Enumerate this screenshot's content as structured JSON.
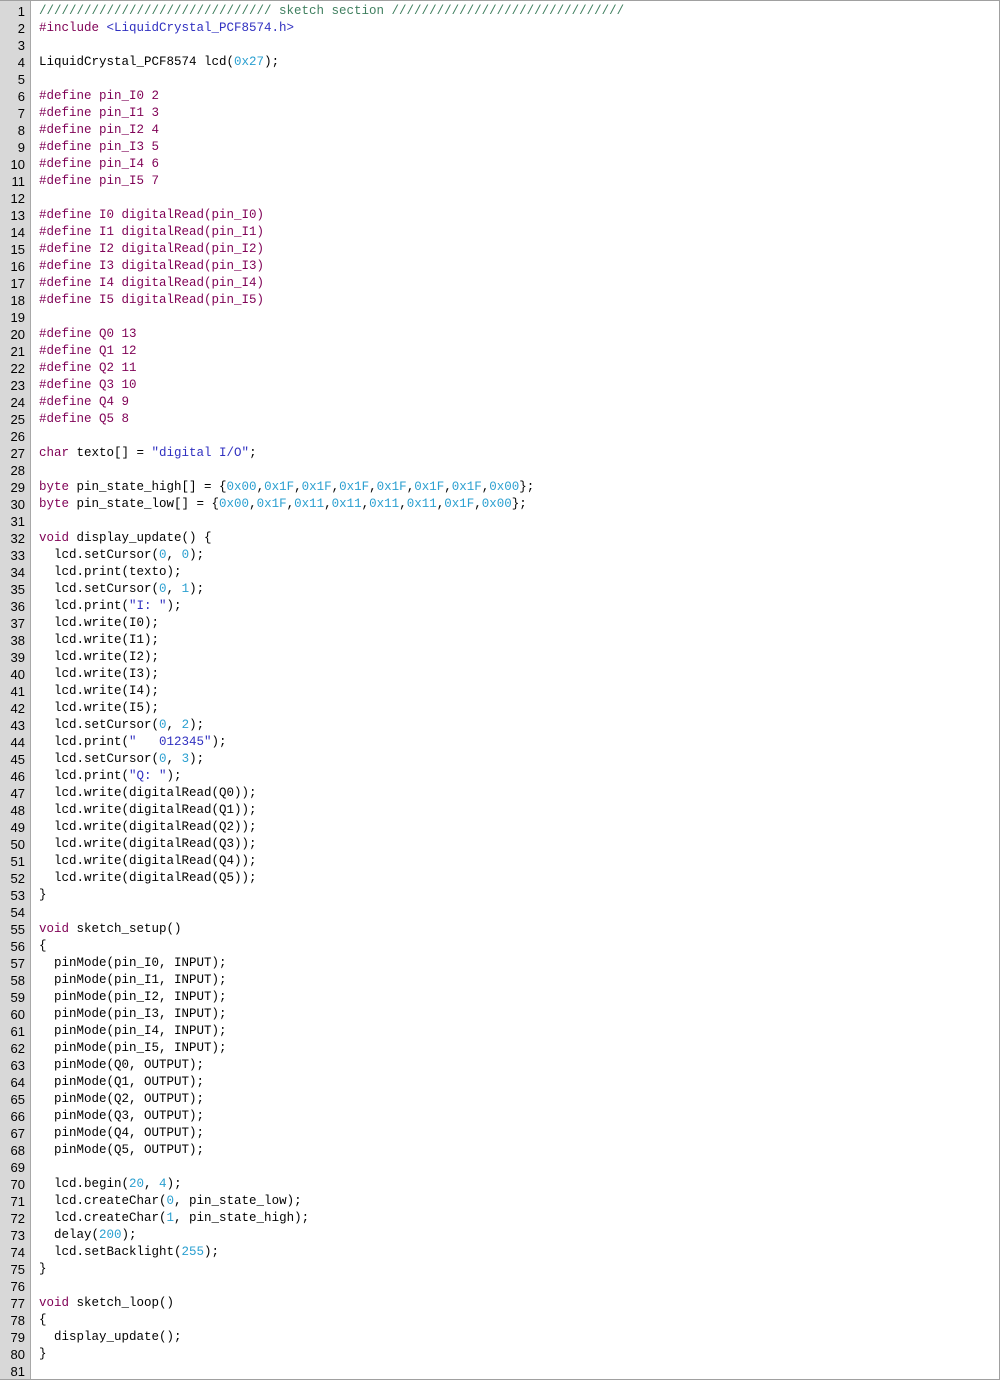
{
  "colors": {
    "keyword": "#7f0055",
    "number": "#2a9fd0",
    "string": "#3030c0",
    "comment": "#3f7f5f",
    "plain": "#000000",
    "gutter": "#d8d8d8"
  },
  "editor": {
    "lines": [
      {
        "n": "1",
        "tokens": [
          {
            "t": "cm",
            "s": "/////////////////////////////// sketch section ///////////////////////////////"
          }
        ]
      },
      {
        "n": "2",
        "tokens": [
          {
            "t": "kw",
            "s": "#include "
          },
          {
            "t": "str",
            "s": "<LiquidCrystal_PCF8574.h>"
          }
        ]
      },
      {
        "n": "3",
        "tokens": []
      },
      {
        "n": "4",
        "tokens": [
          {
            "t": "plain",
            "s": "LiquidCrystal_PCF8574 lcd("
          },
          {
            "t": "num",
            "s": "0x27"
          },
          {
            "t": "plain",
            "s": ");"
          }
        ]
      },
      {
        "n": "5",
        "tokens": []
      },
      {
        "n": "6",
        "tokens": [
          {
            "t": "kw",
            "s": "#define pin_I0 2"
          }
        ]
      },
      {
        "n": "7",
        "tokens": [
          {
            "t": "kw",
            "s": "#define pin_I1 3"
          }
        ]
      },
      {
        "n": "8",
        "tokens": [
          {
            "t": "kw",
            "s": "#define pin_I2 4"
          }
        ]
      },
      {
        "n": "9",
        "tokens": [
          {
            "t": "kw",
            "s": "#define pin_I3 5"
          }
        ]
      },
      {
        "n": "10",
        "tokens": [
          {
            "t": "kw",
            "s": "#define pin_I4 6"
          }
        ]
      },
      {
        "n": "11",
        "tokens": [
          {
            "t": "kw",
            "s": "#define pin_I5 7"
          }
        ]
      },
      {
        "n": "12",
        "tokens": []
      },
      {
        "n": "13",
        "tokens": [
          {
            "t": "kw",
            "s": "#define I0 digitalRead(pin_I0)"
          }
        ]
      },
      {
        "n": "14",
        "tokens": [
          {
            "t": "kw",
            "s": "#define I1 digitalRead(pin_I1)"
          }
        ]
      },
      {
        "n": "15",
        "tokens": [
          {
            "t": "kw",
            "s": "#define I2 digitalRead(pin_I2)"
          }
        ]
      },
      {
        "n": "16",
        "tokens": [
          {
            "t": "kw",
            "s": "#define I3 digitalRead(pin_I3)"
          }
        ]
      },
      {
        "n": "17",
        "tokens": [
          {
            "t": "kw",
            "s": "#define I4 digitalRead(pin_I4)"
          }
        ]
      },
      {
        "n": "18",
        "tokens": [
          {
            "t": "kw",
            "s": "#define I5 digitalRead(pin_I5)"
          }
        ]
      },
      {
        "n": "19",
        "tokens": []
      },
      {
        "n": "20",
        "tokens": [
          {
            "t": "kw",
            "s": "#define Q0 13"
          }
        ]
      },
      {
        "n": "21",
        "tokens": [
          {
            "t": "kw",
            "s": "#define Q1 12"
          }
        ]
      },
      {
        "n": "22",
        "tokens": [
          {
            "t": "kw",
            "s": "#define Q2 11"
          }
        ]
      },
      {
        "n": "23",
        "tokens": [
          {
            "t": "kw",
            "s": "#define Q3 10"
          }
        ]
      },
      {
        "n": "24",
        "tokens": [
          {
            "t": "kw",
            "s": "#define Q4 9"
          }
        ]
      },
      {
        "n": "25",
        "tokens": [
          {
            "t": "kw",
            "s": "#define Q5 8"
          }
        ]
      },
      {
        "n": "26",
        "tokens": []
      },
      {
        "n": "27",
        "tokens": [
          {
            "t": "kw",
            "s": "char"
          },
          {
            "t": "plain",
            "s": " texto[] = "
          },
          {
            "t": "str",
            "s": "\"digital I/O\""
          },
          {
            "t": "plain",
            "s": ";"
          }
        ]
      },
      {
        "n": "28",
        "tokens": []
      },
      {
        "n": "29",
        "tokens": [
          {
            "t": "kw",
            "s": "byte"
          },
          {
            "t": "plain",
            "s": " pin_state_high[] = {"
          },
          {
            "t": "num",
            "s": "0x00"
          },
          {
            "t": "plain",
            "s": ","
          },
          {
            "t": "num",
            "s": "0x1F"
          },
          {
            "t": "plain",
            "s": ","
          },
          {
            "t": "num",
            "s": "0x1F"
          },
          {
            "t": "plain",
            "s": ","
          },
          {
            "t": "num",
            "s": "0x1F"
          },
          {
            "t": "plain",
            "s": ","
          },
          {
            "t": "num",
            "s": "0x1F"
          },
          {
            "t": "plain",
            "s": ","
          },
          {
            "t": "num",
            "s": "0x1F"
          },
          {
            "t": "plain",
            "s": ","
          },
          {
            "t": "num",
            "s": "0x1F"
          },
          {
            "t": "plain",
            "s": ","
          },
          {
            "t": "num",
            "s": "0x00"
          },
          {
            "t": "plain",
            "s": "};"
          }
        ]
      },
      {
        "n": "30",
        "tokens": [
          {
            "t": "kw",
            "s": "byte"
          },
          {
            "t": "plain",
            "s": " pin_state_low[] = {"
          },
          {
            "t": "num",
            "s": "0x00"
          },
          {
            "t": "plain",
            "s": ","
          },
          {
            "t": "num",
            "s": "0x1F"
          },
          {
            "t": "plain",
            "s": ","
          },
          {
            "t": "num",
            "s": "0x11"
          },
          {
            "t": "plain",
            "s": ","
          },
          {
            "t": "num",
            "s": "0x11"
          },
          {
            "t": "plain",
            "s": ","
          },
          {
            "t": "num",
            "s": "0x11"
          },
          {
            "t": "plain",
            "s": ","
          },
          {
            "t": "num",
            "s": "0x11"
          },
          {
            "t": "plain",
            "s": ","
          },
          {
            "t": "num",
            "s": "0x1F"
          },
          {
            "t": "plain",
            "s": ","
          },
          {
            "t": "num",
            "s": "0x00"
          },
          {
            "t": "plain",
            "s": "};"
          }
        ]
      },
      {
        "n": "31",
        "tokens": []
      },
      {
        "n": "32",
        "tokens": [
          {
            "t": "kw",
            "s": "void"
          },
          {
            "t": "plain",
            "s": " display_update() {"
          }
        ]
      },
      {
        "n": "33",
        "tokens": [
          {
            "t": "plain",
            "s": "  lcd.setCursor("
          },
          {
            "t": "num",
            "s": "0"
          },
          {
            "t": "plain",
            "s": ", "
          },
          {
            "t": "num",
            "s": "0"
          },
          {
            "t": "plain",
            "s": ");"
          }
        ]
      },
      {
        "n": "34",
        "tokens": [
          {
            "t": "plain",
            "s": "  lcd.print(texto);"
          }
        ]
      },
      {
        "n": "35",
        "tokens": [
          {
            "t": "plain",
            "s": "  lcd.setCursor("
          },
          {
            "t": "num",
            "s": "0"
          },
          {
            "t": "plain",
            "s": ", "
          },
          {
            "t": "num",
            "s": "1"
          },
          {
            "t": "plain",
            "s": ");"
          }
        ]
      },
      {
        "n": "36",
        "tokens": [
          {
            "t": "plain",
            "s": "  lcd.print("
          },
          {
            "t": "str",
            "s": "\"I: \""
          },
          {
            "t": "plain",
            "s": ");"
          }
        ]
      },
      {
        "n": "37",
        "tokens": [
          {
            "t": "plain",
            "s": "  lcd.write(I0);"
          }
        ]
      },
      {
        "n": "38",
        "tokens": [
          {
            "t": "plain",
            "s": "  lcd.write(I1);"
          }
        ]
      },
      {
        "n": "39",
        "tokens": [
          {
            "t": "plain",
            "s": "  lcd.write(I2);"
          }
        ]
      },
      {
        "n": "40",
        "tokens": [
          {
            "t": "plain",
            "s": "  lcd.write(I3);"
          }
        ]
      },
      {
        "n": "41",
        "tokens": [
          {
            "t": "plain",
            "s": "  lcd.write(I4);"
          }
        ]
      },
      {
        "n": "42",
        "tokens": [
          {
            "t": "plain",
            "s": "  lcd.write(I5);"
          }
        ]
      },
      {
        "n": "43",
        "tokens": [
          {
            "t": "plain",
            "s": "  lcd.setCursor("
          },
          {
            "t": "num",
            "s": "0"
          },
          {
            "t": "plain",
            "s": ", "
          },
          {
            "t": "num",
            "s": "2"
          },
          {
            "t": "plain",
            "s": ");"
          }
        ]
      },
      {
        "n": "44",
        "tokens": [
          {
            "t": "plain",
            "s": "  lcd.print("
          },
          {
            "t": "str",
            "s": "\"   012345\""
          },
          {
            "t": "plain",
            "s": ");"
          }
        ]
      },
      {
        "n": "45",
        "tokens": [
          {
            "t": "plain",
            "s": "  lcd.setCursor("
          },
          {
            "t": "num",
            "s": "0"
          },
          {
            "t": "plain",
            "s": ", "
          },
          {
            "t": "num",
            "s": "3"
          },
          {
            "t": "plain",
            "s": ");"
          }
        ]
      },
      {
        "n": "46",
        "tokens": [
          {
            "t": "plain",
            "s": "  lcd.print("
          },
          {
            "t": "str",
            "s": "\"Q: \""
          },
          {
            "t": "plain",
            "s": ");"
          }
        ]
      },
      {
        "n": "47",
        "tokens": [
          {
            "t": "plain",
            "s": "  lcd.write(digitalRead(Q0));"
          }
        ]
      },
      {
        "n": "48",
        "tokens": [
          {
            "t": "plain",
            "s": "  lcd.write(digitalRead(Q1));"
          }
        ]
      },
      {
        "n": "49",
        "tokens": [
          {
            "t": "plain",
            "s": "  lcd.write(digitalRead(Q2));"
          }
        ]
      },
      {
        "n": "50",
        "tokens": [
          {
            "t": "plain",
            "s": "  lcd.write(digitalRead(Q3));"
          }
        ]
      },
      {
        "n": "51",
        "tokens": [
          {
            "t": "plain",
            "s": "  lcd.write(digitalRead(Q4));"
          }
        ]
      },
      {
        "n": "52",
        "tokens": [
          {
            "t": "plain",
            "s": "  lcd.write(digitalRead(Q5));"
          }
        ]
      },
      {
        "n": "53",
        "tokens": [
          {
            "t": "plain",
            "s": "}"
          }
        ]
      },
      {
        "n": "54",
        "tokens": []
      },
      {
        "n": "55",
        "tokens": [
          {
            "t": "kw",
            "s": "void"
          },
          {
            "t": "plain",
            "s": " sketch_setup()"
          }
        ]
      },
      {
        "n": "56",
        "tokens": [
          {
            "t": "plain",
            "s": "{"
          }
        ]
      },
      {
        "n": "57",
        "tokens": [
          {
            "t": "plain",
            "s": "  pinMode(pin_I0, INPUT);"
          }
        ]
      },
      {
        "n": "58",
        "tokens": [
          {
            "t": "plain",
            "s": "  pinMode(pin_I1, INPUT);"
          }
        ]
      },
      {
        "n": "59",
        "tokens": [
          {
            "t": "plain",
            "s": "  pinMode(pin_I2, INPUT);"
          }
        ]
      },
      {
        "n": "60",
        "tokens": [
          {
            "t": "plain",
            "s": "  pinMode(pin_I3, INPUT);"
          }
        ]
      },
      {
        "n": "61",
        "tokens": [
          {
            "t": "plain",
            "s": "  pinMode(pin_I4, INPUT);"
          }
        ]
      },
      {
        "n": "62",
        "tokens": [
          {
            "t": "plain",
            "s": "  pinMode(pin_I5, INPUT);"
          }
        ]
      },
      {
        "n": "63",
        "tokens": [
          {
            "t": "plain",
            "s": "  pinMode(Q0, OUTPUT);"
          }
        ]
      },
      {
        "n": "64",
        "tokens": [
          {
            "t": "plain",
            "s": "  pinMode(Q1, OUTPUT);"
          }
        ]
      },
      {
        "n": "65",
        "tokens": [
          {
            "t": "plain",
            "s": "  pinMode(Q2, OUTPUT);"
          }
        ]
      },
      {
        "n": "66",
        "tokens": [
          {
            "t": "plain",
            "s": "  pinMode(Q3, OUTPUT);"
          }
        ]
      },
      {
        "n": "67",
        "tokens": [
          {
            "t": "plain",
            "s": "  pinMode(Q4, OUTPUT);"
          }
        ]
      },
      {
        "n": "68",
        "tokens": [
          {
            "t": "plain",
            "s": "  pinMode(Q5, OUTPUT);"
          }
        ]
      },
      {
        "n": "69",
        "tokens": []
      },
      {
        "n": "70",
        "tokens": [
          {
            "t": "plain",
            "s": "  lcd.begin("
          },
          {
            "t": "num",
            "s": "20"
          },
          {
            "t": "plain",
            "s": ", "
          },
          {
            "t": "num",
            "s": "4"
          },
          {
            "t": "plain",
            "s": ");"
          }
        ]
      },
      {
        "n": "71",
        "tokens": [
          {
            "t": "plain",
            "s": "  lcd.createChar("
          },
          {
            "t": "num",
            "s": "0"
          },
          {
            "t": "plain",
            "s": ", pin_state_low);"
          }
        ]
      },
      {
        "n": "72",
        "tokens": [
          {
            "t": "plain",
            "s": "  lcd.createChar("
          },
          {
            "t": "num",
            "s": "1"
          },
          {
            "t": "plain",
            "s": ", pin_state_high);"
          }
        ]
      },
      {
        "n": "73",
        "tokens": [
          {
            "t": "plain",
            "s": "  delay("
          },
          {
            "t": "num",
            "s": "200"
          },
          {
            "t": "plain",
            "s": ");"
          }
        ]
      },
      {
        "n": "74",
        "tokens": [
          {
            "t": "plain",
            "s": "  lcd.setBacklight("
          },
          {
            "t": "num",
            "s": "255"
          },
          {
            "t": "plain",
            "s": ");"
          }
        ]
      },
      {
        "n": "75",
        "tokens": [
          {
            "t": "plain",
            "s": "}"
          }
        ]
      },
      {
        "n": "76",
        "tokens": []
      },
      {
        "n": "77",
        "tokens": [
          {
            "t": "kw",
            "s": "void"
          },
          {
            "t": "plain",
            "s": " sketch_loop()"
          }
        ]
      },
      {
        "n": "78",
        "tokens": [
          {
            "t": "plain",
            "s": "{"
          }
        ]
      },
      {
        "n": "79",
        "tokens": [
          {
            "t": "plain",
            "s": "  display_update();"
          }
        ]
      },
      {
        "n": "80",
        "tokens": [
          {
            "t": "plain",
            "s": "}"
          }
        ]
      },
      {
        "n": "81",
        "tokens": []
      }
    ]
  }
}
